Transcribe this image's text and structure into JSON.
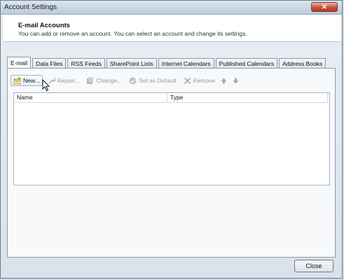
{
  "window": {
    "title": "Account Settings",
    "close_glyph": "✕"
  },
  "header": {
    "title": "E-mail Accounts",
    "description": "You can add or remove an account. You can select an account and change its settings."
  },
  "tabs": [
    {
      "label": "E-mail",
      "active": true
    },
    {
      "label": "Data Files"
    },
    {
      "label": "RSS Feeds"
    },
    {
      "label": "SharePoint Lists"
    },
    {
      "label": "Internet Calendars"
    },
    {
      "label": "Published Calendars"
    },
    {
      "label": "Address Books"
    }
  ],
  "toolbar": {
    "new_label": "New...",
    "repair_label": "Repair...",
    "change_label": "Change...",
    "set_default_label": "Set as Default",
    "remove_label": "Remove"
  },
  "list": {
    "columns": [
      "Name",
      "Type"
    ],
    "rows": []
  },
  "footer": {
    "close_label": "Close"
  }
}
